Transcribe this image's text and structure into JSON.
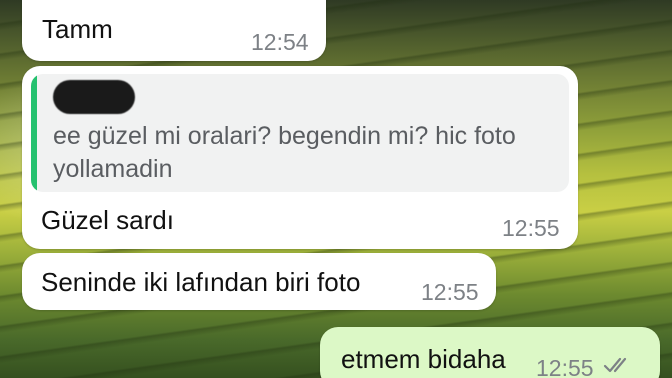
{
  "messages": [
    {
      "text": "Tamm",
      "time": "12:54",
      "direction": "incoming"
    },
    {
      "quote": {
        "author_redacted": true,
        "text": "ee güzel mi oralari? begendin mi? hic foto yollamadin",
        "bar_color": "#25c16f"
      },
      "text": "Güzel sardı",
      "time": "12:55",
      "direction": "incoming"
    },
    {
      "text": "Seninde iki lafından biri foto",
      "time": "12:55",
      "direction": "incoming"
    },
    {
      "text": "etmem bidaha",
      "time": "12:55",
      "direction": "outgoing",
      "status_icon": "double-check-icon"
    }
  ],
  "colors": {
    "incoming_bubble": "#ffffff",
    "outgoing_bubble": "#dcf8c6",
    "timestamp": "#7d8186",
    "quote_bar": "#25c16f"
  }
}
